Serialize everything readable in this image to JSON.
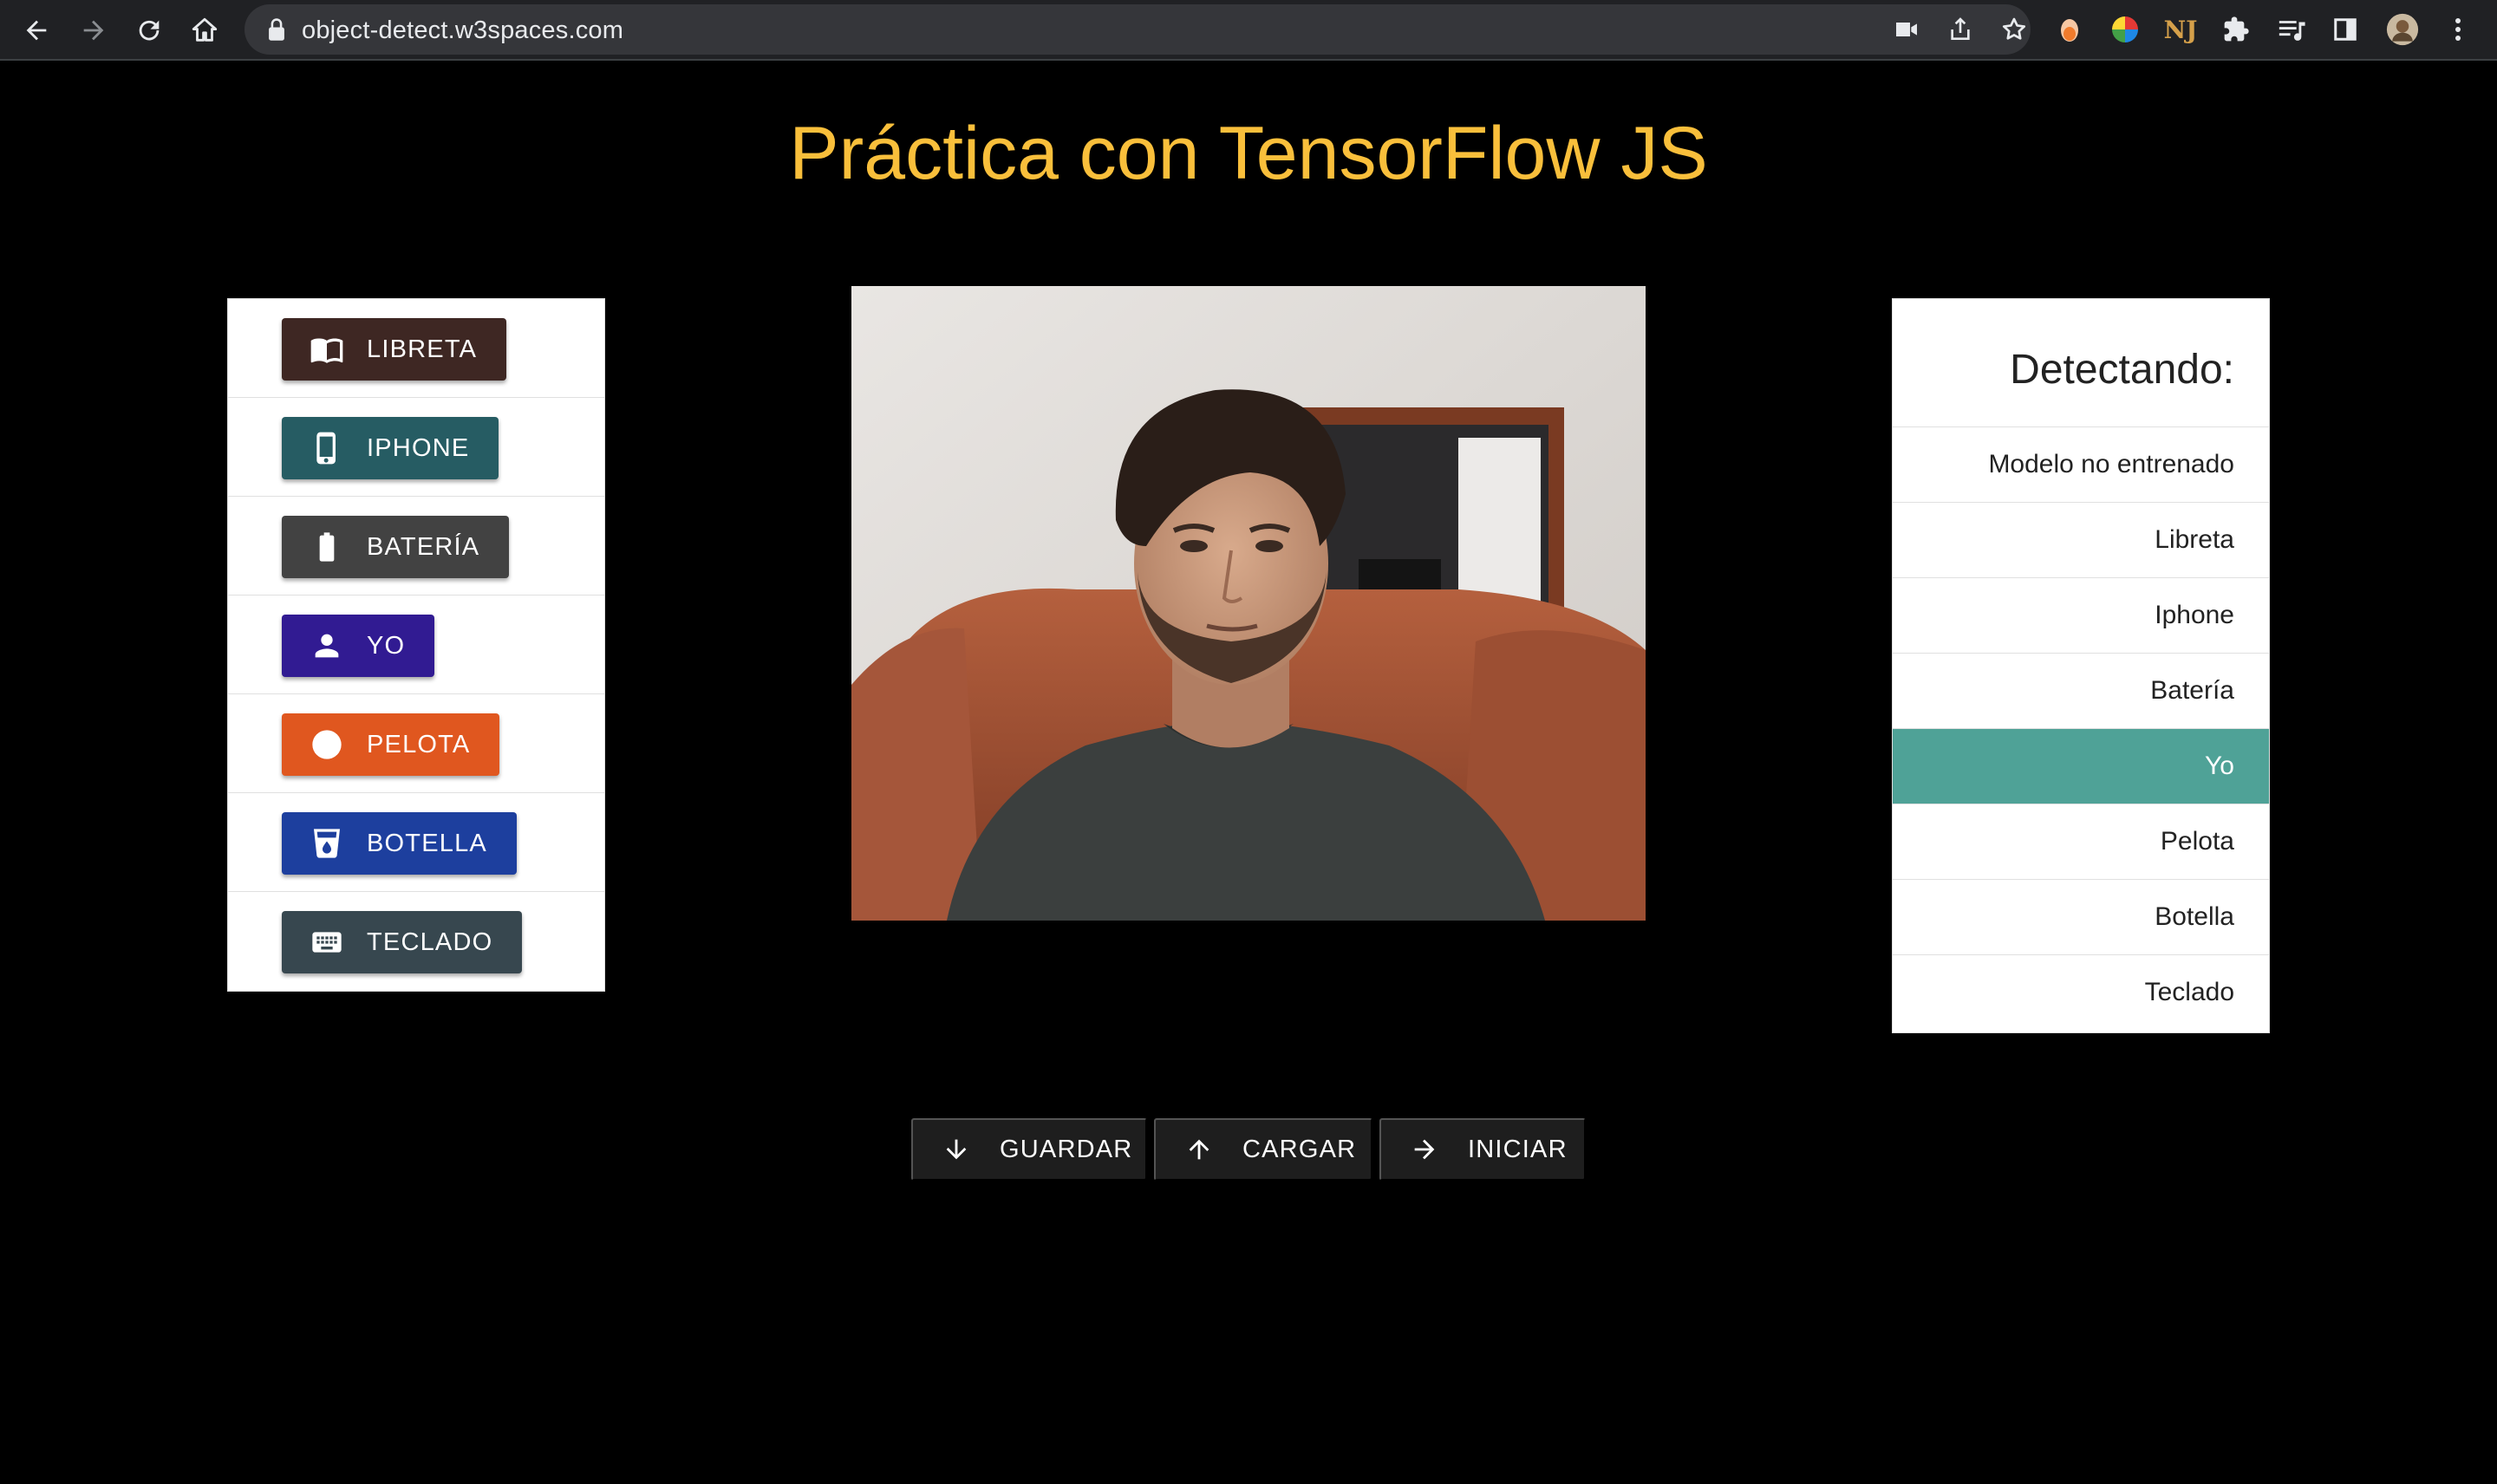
{
  "browser": {
    "url": "object-detect.w3spaces.com",
    "icons": [
      "back-icon",
      "forward-icon",
      "reload-icon",
      "home-icon",
      "lock-icon",
      "camera-icon",
      "share-icon",
      "star-icon",
      "extension-icons",
      "puzzle-icon",
      "media-icon",
      "sidebar-icon",
      "profile-avatar",
      "menu-icon"
    ]
  },
  "page": {
    "title": "Práctica con TensorFlow JS",
    "title_color": "#f9bf3b",
    "background": "#000000"
  },
  "classes": [
    {
      "label": "LIBRETA",
      "icon": "book-icon",
      "color": "#3e2723"
    },
    {
      "label": "IPHONE",
      "icon": "phone-icon",
      "color": "#265c63"
    },
    {
      "label": "BATERÍA",
      "icon": "battery-icon",
      "color": "#424242"
    },
    {
      "label": "YO",
      "icon": "person-icon",
      "color": "#311b92"
    },
    {
      "label": "PELOTA",
      "icon": "circle-icon",
      "color": "#e0571f"
    },
    {
      "label": "BOTELLA",
      "icon": "bottle-icon",
      "color": "#1d3f9e"
    },
    {
      "label": "TECLADO",
      "icon": "keyboard-icon",
      "color": "#37474f"
    }
  ],
  "detection": {
    "header": "Detectando:",
    "items": [
      "Modelo no entrenado",
      "Libreta",
      "Iphone",
      "Batería",
      "Yo",
      "Pelota",
      "Botella",
      "Teclado"
    ],
    "active_item": "Yo",
    "active_color": "#4fa297"
  },
  "actions": [
    {
      "label": "GUARDAR",
      "icon": "arrow-down-icon"
    },
    {
      "label": "CARGAR",
      "icon": "arrow-up-icon"
    },
    {
      "label": "INICIAR",
      "icon": "arrow-right-icon"
    }
  ]
}
